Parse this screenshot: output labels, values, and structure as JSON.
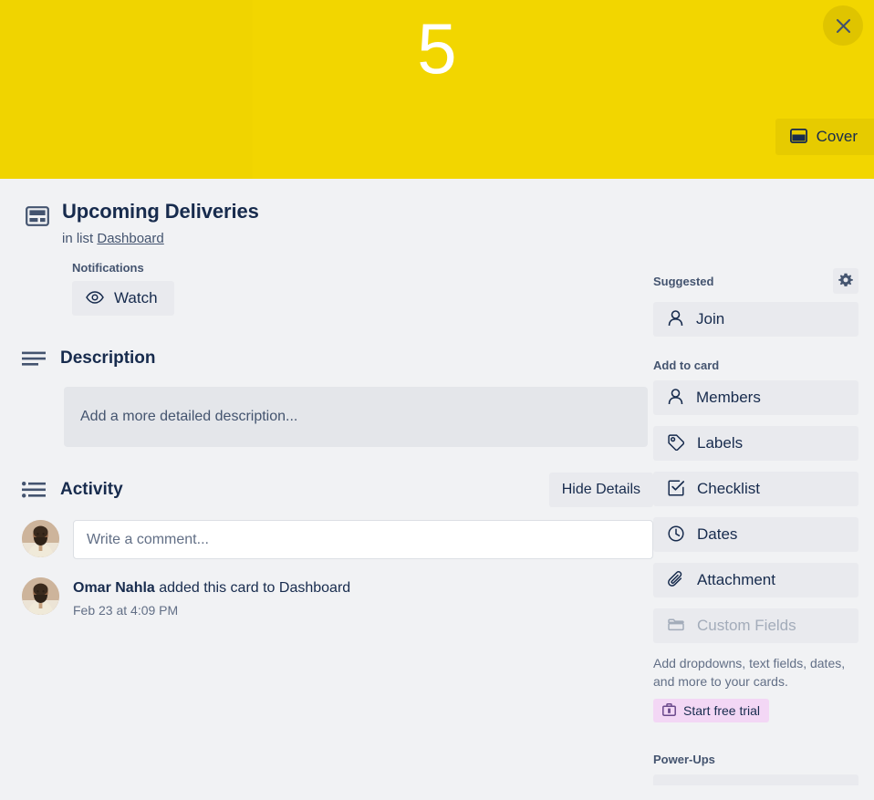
{
  "cover": {
    "number": "5",
    "close_icon": "close-icon",
    "cover_button": {
      "label": "Cover",
      "icon": "cover-icon"
    },
    "color": "#f2d600"
  },
  "card": {
    "icon": "card-template-icon",
    "title": "Upcoming Deliveries",
    "list_prefix": "in list",
    "list_name": "Dashboard"
  },
  "notifications": {
    "label": "Notifications",
    "watch_button": {
      "label": "Watch",
      "icon": "eye-icon"
    }
  },
  "description": {
    "icon": "description-lines-icon",
    "title": "Description",
    "placeholder": "Add a more detailed description..."
  },
  "activity": {
    "icon": "activity-list-icon",
    "title": "Activity",
    "hide_details_label": "Hide Details",
    "comment_placeholder": "Write a comment...",
    "avatar": "user-avatar",
    "entries": [
      {
        "author": "Omar Nahla",
        "action": " added this card to Dashboard",
        "timestamp": "Feb 23 at 4:09 PM"
      }
    ]
  },
  "sidebar": {
    "suggested_label": "Suggested",
    "settings_icon": "gear-icon",
    "suggested_items": [
      {
        "label": "Join",
        "icon": "person-icon"
      }
    ],
    "add_to_card_label": "Add to card",
    "add_to_card_items": [
      {
        "label": "Members",
        "icon": "person-icon",
        "disabled": false
      },
      {
        "label": "Labels",
        "icon": "label-tag-icon",
        "disabled": false
      },
      {
        "label": "Checklist",
        "icon": "checklist-icon",
        "disabled": false
      },
      {
        "label": "Dates",
        "icon": "clock-icon",
        "disabled": false
      },
      {
        "label": "Attachment",
        "icon": "paperclip-icon",
        "disabled": false
      },
      {
        "label": "Custom Fields",
        "icon": "custom-fields-icon",
        "disabled": true
      }
    ],
    "custom_fields_note": "Add dropdowns, text fields, dates, and more to your cards.",
    "trial_button": {
      "label": "Start free trial",
      "icon": "briefcase-icon"
    },
    "powerups_label": "Power-Ups"
  }
}
